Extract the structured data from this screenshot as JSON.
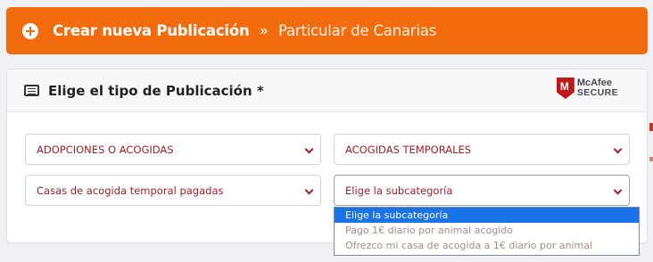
{
  "header": {
    "title": "Crear nueva Publicación",
    "separator": "»",
    "subtitle": "Particular de Canarias",
    "icon": "plus-circle-icon",
    "background": "#f26b0c"
  },
  "card": {
    "title": "Elige el tipo de Publicación *",
    "icon": "list-icon",
    "badge": {
      "brand": "McAfee",
      "secure": "SECURE"
    }
  },
  "selects": {
    "category": "ADOPCIONES O ACOGIDAS",
    "type": "ACOGIDAS TEMPORALES",
    "subtype": "Casas de acogida temporal pagadas",
    "subcategory": "Elige la subcategoría"
  },
  "dropdown": {
    "options": [
      "Elige la subcategoría",
      "Pago 1€ diario por animal acogido",
      "Ofrezco mi casa de acogida a 1€ diario por animal"
    ],
    "selected_index": 0
  },
  "colors": {
    "accent": "#f26b0c",
    "select_text": "#a11f2a",
    "highlight": "#1a73e8"
  }
}
